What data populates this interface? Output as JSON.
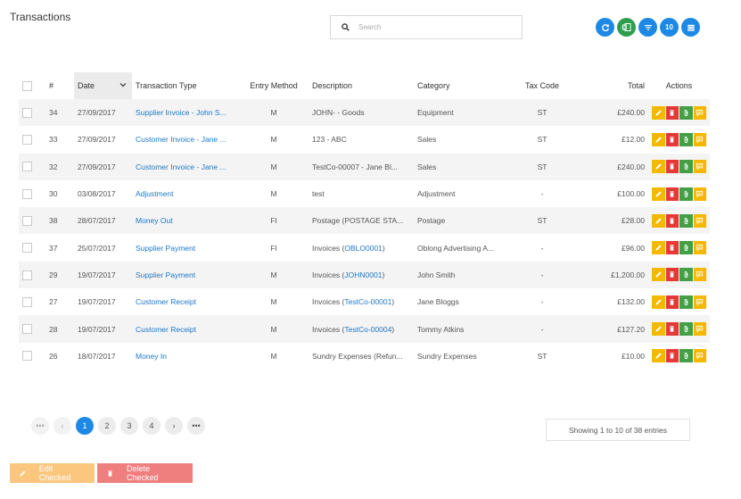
{
  "page_title": "Transactions",
  "search": {
    "placeholder": "Search"
  },
  "toolbar": {
    "page_size": "10"
  },
  "columns": [
    "#",
    "Date",
    "Transaction Type",
    "Entry Method",
    "Description",
    "Category",
    "Tax Code",
    "Total",
    "Actions"
  ],
  "rows": [
    {
      "id": "34",
      "date": "27/09/2017",
      "type": "Supplier Invoice - John S...",
      "method": "M",
      "desc": "JOHN- - Goods",
      "desc_link": "",
      "desc_tail": "",
      "category": "Equipment",
      "tax": "ST",
      "total": "£240.00"
    },
    {
      "id": "33",
      "date": "27/09/2017",
      "type": "Customer Invoice - Jane ...",
      "method": "M",
      "desc": "123 - ABC",
      "desc_link": "",
      "desc_tail": "",
      "category": "Sales",
      "tax": "ST",
      "total": "£12.00"
    },
    {
      "id": "32",
      "date": "27/09/2017",
      "type": "Customer Invoice - Jane ...",
      "method": "M",
      "desc": "TestCo-00007 - Jane Bl...",
      "desc_link": "",
      "desc_tail": "",
      "category": "Sales",
      "tax": "ST",
      "total": "£240.00"
    },
    {
      "id": "30",
      "date": "03/08/2017",
      "type": "Adjustment",
      "method": "M",
      "desc": "test",
      "desc_link": "",
      "desc_tail": "",
      "category": "Adjustment",
      "tax": "-",
      "total": "£100.00"
    },
    {
      "id": "38",
      "date": "28/07/2017",
      "type": "Money Out",
      "method": "FI",
      "desc": "Postage (POSTAGE STA...",
      "desc_link": "",
      "desc_tail": "",
      "category": "Postage",
      "tax": "ST",
      "total": "£28.00"
    },
    {
      "id": "37",
      "date": "25/07/2017",
      "type": "Supplier Payment",
      "method": "FI",
      "desc": "Invoices (",
      "desc_link": "OBLO0001",
      "desc_tail": ")",
      "category": "Oblong Advertising A...",
      "tax": "-",
      "total": "£96.00"
    },
    {
      "id": "29",
      "date": "19/07/2017",
      "type": "Supplier Payment",
      "method": "M",
      "desc": "Invoices (",
      "desc_link": "JOHN0001",
      "desc_tail": ")",
      "category": "John Smith",
      "tax": "-",
      "total": "£1,200.00"
    },
    {
      "id": "27",
      "date": "19/07/2017",
      "type": "Customer Receipt",
      "method": "M",
      "desc": "Invoices (",
      "desc_link": "TestCo-00001",
      "desc_tail": ")",
      "category": "Jane Bloggs",
      "tax": "-",
      "total": "£132.00"
    },
    {
      "id": "28",
      "date": "19/07/2017",
      "type": "Customer Receipt",
      "method": "M",
      "desc": "Invoices (",
      "desc_link": "TestCo-00004",
      "desc_tail": ")",
      "category": "Tommy Atkins",
      "tax": "-",
      "total": "£127.20"
    },
    {
      "id": "26",
      "date": "18/07/2017",
      "type": "Money In",
      "method": "M",
      "desc": "Sundry Expenses (Refun...",
      "desc_link": "",
      "desc_tail": "",
      "category": "Sundry Expenses",
      "tax": "ST",
      "total": "£10.00"
    }
  ],
  "pagination": {
    "first": "•••",
    "prev": "‹",
    "pages": [
      "1",
      "2",
      "3",
      "4"
    ],
    "next": "›",
    "last": "•••",
    "current": "1"
  },
  "info": "Showing 1 to 10 of 38 entries",
  "bottom": {
    "edit_label": "Edit Checked",
    "delete_label": "Delete Checked"
  },
  "colors": {
    "primary": "#1e88e5",
    "link": "#1e78c8",
    "edit": "#f5b800",
    "delete": "#e53935",
    "attach": "#43a047",
    "excel": "#2e9e4f"
  },
  "icons": {
    "refresh": "refresh-icon",
    "excel": "excel-icon",
    "filter": "filter-icon",
    "columns": "columns-icon",
    "search": "search-icon",
    "sort": "chevron-down-icon",
    "edit": "pencil-icon",
    "delete": "trash-icon",
    "attach": "paperclip-icon",
    "note": "comment-icon"
  }
}
